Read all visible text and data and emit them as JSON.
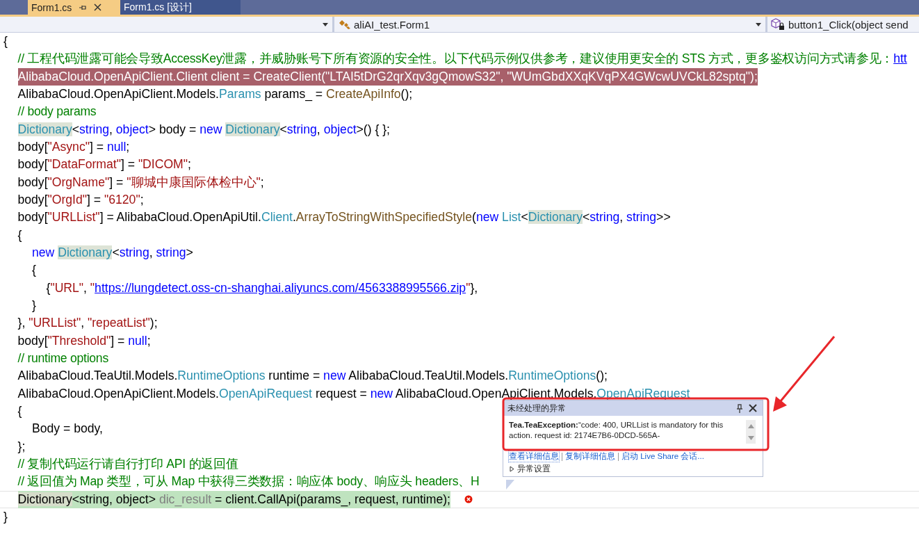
{
  "tabs": [
    {
      "label": "Form1.cs",
      "selected": true
    },
    {
      "label": "Form1.cs [设计]",
      "selected": false
    }
  ],
  "nav_bar": [
    {
      "kind": "empty"
    },
    {
      "kind": "class",
      "label": "aliAI_test.Form1"
    },
    {
      "kind": "method",
      "label": "button1_Click(object send"
    }
  ],
  "code_lines": [
    {
      "kind": "normal",
      "tokens": [
        {
          "kind": "plain",
          "text": "{"
        }
      ],
      "children": [
        {
          "kind": "normal",
          "tokens": [
            {
              "kind": "comment",
              "text": "// 工程代码泄露可能会导致AccessKey泄露，并威胁账号下所有资源的安全性。以下代码示例仅供参考，建议使用更安全的 STS 方式，更多鉴权访问方式请参见："
            },
            {
              "kind": "link",
              "text": "htt"
            }
          ]
        },
        {
          "kind": "highlighted",
          "tokens": [
            {
              "kind": "plain",
              "text": "AlibabaCloud.OpenApiClient.Client client = CreateClient(\"LTAI5tDrG2qrXqv3gQmowS32\", \"WUmGbdXXqKVqPX4GWcwUVCkL82sptq\");"
            }
          ]
        },
        {
          "kind": "normal",
          "tokens": [
            {
              "kind": "plain",
              "text": "AlibabaCloud.OpenApiClient.Models."
            },
            {
              "kind": "type",
              "text": "Params"
            },
            {
              "kind": "plain",
              "text": " params_ = "
            },
            {
              "kind": "method",
              "text": "CreateApiInfo"
            },
            {
              "kind": "plain",
              "text": "();"
            }
          ]
        },
        {
          "kind": "normal",
          "tokens": [
            {
              "kind": "comment",
              "text": "// body params"
            }
          ]
        },
        {
          "kind": "normal",
          "tokens": [
            {
              "kind": "typeref",
              "text": "Dictionary"
            },
            {
              "kind": "plain",
              "text": "<"
            },
            {
              "kind": "keyword",
              "text": "string"
            },
            {
              "kind": "plain",
              "text": ", "
            },
            {
              "kind": "keyword",
              "text": "object"
            },
            {
              "kind": "plain",
              "text": "> body = "
            },
            {
              "kind": "keyword",
              "text": "new "
            },
            {
              "kind": "typeref",
              "text": "Dictionary"
            },
            {
              "kind": "plain",
              "text": "<"
            },
            {
              "kind": "keyword",
              "text": "string"
            },
            {
              "kind": "plain",
              "text": ", "
            },
            {
              "kind": "keyword",
              "text": "object"
            },
            {
              "kind": "plain",
              "text": ">() { };"
            }
          ]
        },
        {
          "kind": "normal",
          "tokens": [
            {
              "kind": "plain",
              "text": "body["
            },
            {
              "kind": "string",
              "text": "\"Async\""
            },
            {
              "kind": "plain",
              "text": "] = "
            },
            {
              "kind": "keyword",
              "text": "null"
            },
            {
              "kind": "plain",
              "text": ";"
            }
          ]
        },
        {
          "kind": "normal",
          "tokens": [
            {
              "kind": "plain",
              "text": "body["
            },
            {
              "kind": "string",
              "text": "\"DataFormat\""
            },
            {
              "kind": "plain",
              "text": "] = "
            },
            {
              "kind": "string",
              "text": "\"DICOM\""
            },
            {
              "kind": "plain",
              "text": ";"
            }
          ]
        },
        {
          "kind": "normal",
          "tokens": [
            {
              "kind": "plain",
              "text": "body["
            },
            {
              "kind": "string",
              "text": "\"OrgName\""
            },
            {
              "kind": "plain",
              "text": "] = "
            },
            {
              "kind": "string",
              "text": "\"聊城中康国际体检中心\""
            },
            {
              "kind": "plain",
              "text": ";"
            }
          ]
        },
        {
          "kind": "normal",
          "tokens": [
            {
              "kind": "plain",
              "text": "body["
            },
            {
              "kind": "string",
              "text": "\"OrgId\""
            },
            {
              "kind": "plain",
              "text": "] = "
            },
            {
              "kind": "string",
              "text": "\"6120\""
            },
            {
              "kind": "plain",
              "text": ";"
            }
          ]
        },
        {
          "kind": "normal",
          "tokens": [
            {
              "kind": "plain",
              "text": "body["
            },
            {
              "kind": "string",
              "text": "\"URLList\""
            },
            {
              "kind": "plain",
              "text": "] = AlibabaCloud.OpenApiUtil."
            },
            {
              "kind": "type",
              "text": "Client"
            },
            {
              "kind": "plain",
              "text": "."
            },
            {
              "kind": "method",
              "text": "ArrayToStringWithSpecifiedStyle"
            },
            {
              "kind": "plain",
              "text": "("
            },
            {
              "kind": "keyword",
              "text": "new"
            },
            {
              "kind": "type",
              "text": " List"
            },
            {
              "kind": "plain",
              "text": "<"
            },
            {
              "kind": "typeref",
              "text": "Dictionary"
            },
            {
              "kind": "plain",
              "text": "<"
            },
            {
              "kind": "keyword",
              "text": "string"
            },
            {
              "kind": "plain",
              "text": ", "
            },
            {
              "kind": "keyword",
              "text": "string"
            },
            {
              "kind": "plain",
              "text": ">>"
            }
          ]
        },
        {
          "kind": "normal",
          "tokens": [
            {
              "kind": "plain",
              "text": "{"
            }
          ],
          "children": [
            {
              "kind": "normal",
              "tokens": [
                {
                  "kind": "keyword",
                  "text": "new "
                },
                {
                  "kind": "typeref",
                  "text": "Dictionary"
                },
                {
                  "kind": "plain",
                  "text": "<"
                },
                {
                  "kind": "keyword",
                  "text": "string"
                },
                {
                  "kind": "plain",
                  "text": ", "
                },
                {
                  "kind": "keyword",
                  "text": "string"
                },
                {
                  "kind": "plain",
                  "text": ">"
                }
              ]
            },
            {
              "kind": "normal",
              "tokens": [
                {
                  "kind": "plain",
                  "text": "{"
                }
              ],
              "children": [
                {
                  "kind": "normal",
                  "tokens": [
                    {
                      "kind": "plain",
                      "text": "{"
                    },
                    {
                      "kind": "string",
                      "text": "\"URL\""
                    },
                    {
                      "kind": "plain",
                      "text": ", "
                    },
                    {
                      "kind": "string",
                      "text": "\""
                    },
                    {
                      "kind": "link",
                      "text": "https://lungdetect.oss-cn-shanghai.aliyuncs.com/4563388995566.zip"
                    },
                    {
                      "kind": "string",
                      "text": "\""
                    },
                    {
                      "kind": "plain",
                      "text": "},"
                    }
                  ]
                }
              ]
            },
            {
              "kind": "normal",
              "tokens": [
                {
                  "kind": "plain",
                  "text": "}"
                }
              ]
            }
          ]
        },
        {
          "kind": "normal",
          "tokens": [
            {
              "kind": "plain",
              "text": "}, "
            },
            {
              "kind": "string",
              "text": "\"URLList\""
            },
            {
              "kind": "plain",
              "text": ", "
            },
            {
              "kind": "string",
              "text": "\"repeatList\""
            },
            {
              "kind": "plain",
              "text": ");"
            }
          ]
        },
        {
          "kind": "normal",
          "tokens": [
            {
              "kind": "plain",
              "text": "body["
            },
            {
              "kind": "string",
              "text": "\"Threshold\""
            },
            {
              "kind": "plain",
              "text": "] = "
            },
            {
              "kind": "keyword",
              "text": "null"
            },
            {
              "kind": "plain",
              "text": ";"
            }
          ]
        },
        {
          "kind": "normal",
          "tokens": [
            {
              "kind": "comment",
              "text": "// runtime options"
            }
          ]
        },
        {
          "kind": "normal",
          "tokens": [
            {
              "kind": "plain",
              "text": "AlibabaCloud.TeaUtil.Models."
            },
            {
              "kind": "type",
              "text": "RuntimeOptions"
            },
            {
              "kind": "plain",
              "text": " runtime = "
            },
            {
              "kind": "keyword",
              "text": "new"
            },
            {
              "kind": "plain",
              "text": " AlibabaCloud.TeaUtil.Models."
            },
            {
              "kind": "type",
              "text": "RuntimeOptions"
            },
            {
              "kind": "plain",
              "text": "();"
            }
          ]
        },
        {
          "kind": "normal",
          "tokens": [
            {
              "kind": "plain",
              "text": "AlibabaCloud.OpenApiClient.Models."
            },
            {
              "kind": "type",
              "text": "OpenApiRequest"
            },
            {
              "kind": "plain",
              "text": " request = "
            },
            {
              "kind": "keyword",
              "text": "new"
            },
            {
              "kind": "plain",
              "text": " AlibabaCloud.OpenApiClient.Models."
            },
            {
              "kind": "type",
              "text": "OpenApiRequest"
            }
          ]
        },
        {
          "kind": "normal",
          "tokens": [
            {
              "kind": "plain",
              "text": "{"
            }
          ],
          "children": [
            {
              "kind": "normal",
              "tokens": [
                {
                  "kind": "plain",
                  "text": "Body = body,"
                }
              ]
            }
          ]
        },
        {
          "kind": "normal",
          "tokens": [
            {
              "kind": "plain",
              "text": "};"
            }
          ]
        },
        {
          "kind": "normal",
          "tokens": [
            {
              "kind": "comment",
              "text": "// 复制代码运行请自行打印 API 的返回值"
            }
          ]
        },
        {
          "kind": "normal",
          "tokens": [
            {
              "kind": "comment",
              "text": "// 返回值为 Map 类型，可从 Map 中获得三类数据：响应体 body、响应头 headers、H"
            }
          ]
        },
        {
          "kind": "current_error",
          "tokens": [
            {
              "kind": "typeref",
              "text": "Dictionary"
            },
            {
              "kind": "plain",
              "text": "<string, object> "
            },
            {
              "kind": "unused",
              "text": "dic_result"
            },
            {
              "kind": "plain",
              "text": " = client.CallApi(params_, request, runtime);"
            }
          ]
        }
      ]
    },
    {
      "kind": "normal",
      "tokens": [
        {
          "kind": "plain",
          "text": "}"
        }
      ]
    }
  ],
  "exception_popup": {
    "title": "未经处理的异常",
    "message": "**Tea.TeaException:**“code: 400, URLList is mandatory for this action. request id: 2174E7B6-0DCD-565A-",
    "links": [
      "查看详细信息",
      "复制详细信息",
      "启动 Live Share 会话..."
    ],
    "settings": {
      "label": "异常设置",
      "expanded": false
    }
  }
}
